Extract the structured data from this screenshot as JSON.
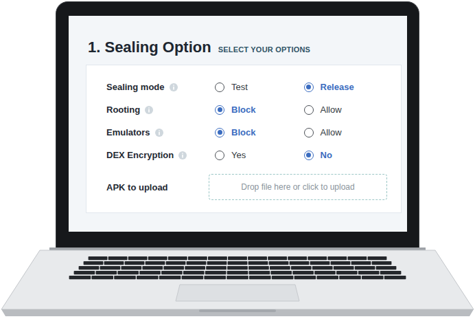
{
  "section": {
    "title": "1. Sealing Option",
    "subtitle": "SELECT YOUR OPTIONS"
  },
  "rows": [
    {
      "kind": "radio",
      "label": "Sealing mode",
      "options": [
        {
          "label": "Test",
          "selected": false
        },
        {
          "label": "Release",
          "selected": true
        }
      ]
    },
    {
      "kind": "radio",
      "label": "Rooting",
      "options": [
        {
          "label": "Block",
          "selected": true
        },
        {
          "label": "Allow",
          "selected": false
        }
      ]
    },
    {
      "kind": "radio",
      "label": "Emulators",
      "options": [
        {
          "label": "Block",
          "selected": true
        },
        {
          "label": "Allow",
          "selected": false
        }
      ]
    },
    {
      "kind": "radio",
      "label": "DEX Encryption",
      "options": [
        {
          "label": "Yes",
          "selected": false
        },
        {
          "label": "No",
          "selected": true
        }
      ]
    },
    {
      "kind": "upload",
      "label": "APK to upload",
      "placeholder": "Drop file here or click to upload"
    }
  ]
}
